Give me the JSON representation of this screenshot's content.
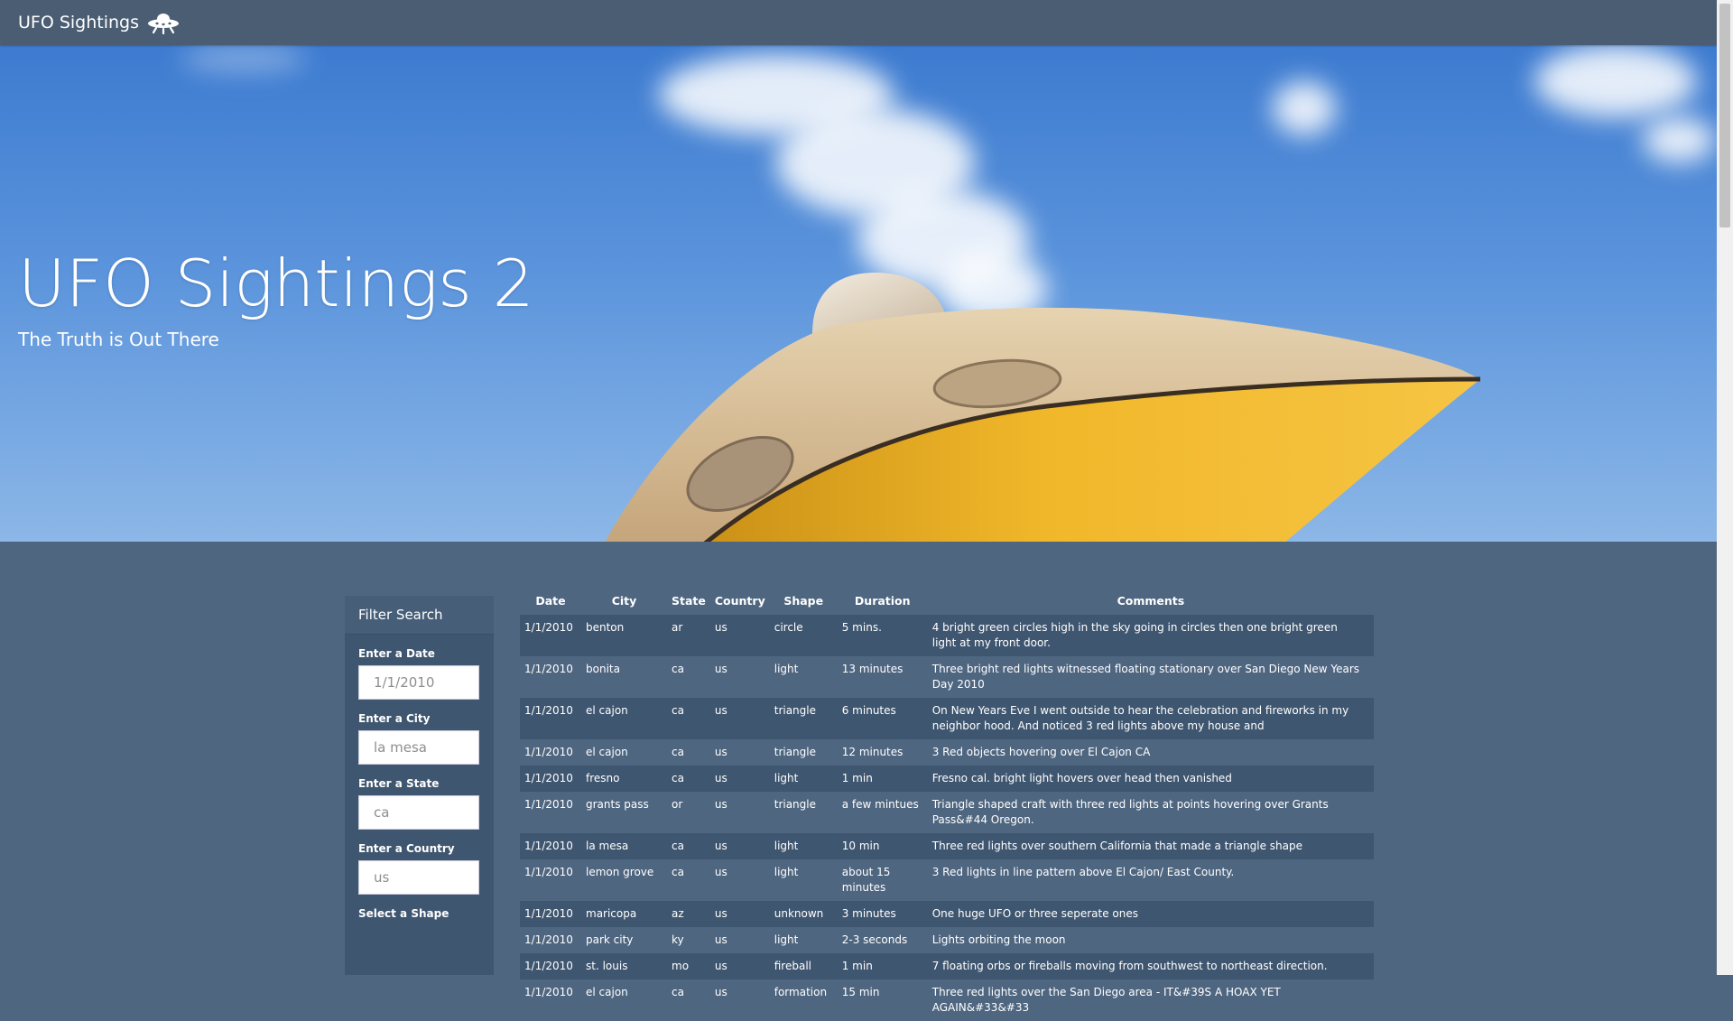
{
  "nav": {
    "brand": "UFO Sightings"
  },
  "hero": {
    "title": "UFO Sightings 2",
    "subtitle": "The Truth is Out There"
  },
  "filter": {
    "heading": "Filter Search",
    "date_label": "Enter a Date",
    "date_placeholder": "1/1/2010",
    "city_label": "Enter a City",
    "city_placeholder": "la mesa",
    "state_label": "Enter a State",
    "state_placeholder": "ca",
    "country_label": "Enter a Country",
    "country_placeholder": "us",
    "shape_label": "Select a Shape"
  },
  "table": {
    "headers": [
      "Date",
      "City",
      "State",
      "Country",
      "Shape",
      "Duration",
      "Comments"
    ],
    "rows": [
      [
        "1/1/2010",
        "benton",
        "ar",
        "us",
        "circle",
        "5 mins.",
        "4 bright green circles high in the sky going in circles then one bright green light at my front door."
      ],
      [
        "1/1/2010",
        "bonita",
        "ca",
        "us",
        "light",
        "13 minutes",
        "Three bright red lights witnessed floating stationary over San Diego New Years Day 2010"
      ],
      [
        "1/1/2010",
        "el cajon",
        "ca",
        "us",
        "triangle",
        "6 minutes",
        "On New Years Eve I went outside to hear the celebration and fireworks in my neighbor hood. And noticed 3 red lights above my house and"
      ],
      [
        "1/1/2010",
        "el cajon",
        "ca",
        "us",
        "triangle",
        "12 minutes",
        "3 Red objects hovering over El Cajon CA"
      ],
      [
        "1/1/2010",
        "fresno",
        "ca",
        "us",
        "light",
        "1 min",
        "Fresno cal. bright light hovers over head then vanished"
      ],
      [
        "1/1/2010",
        "grants pass",
        "or",
        "us",
        "triangle",
        "a few mintues",
        "Triangle shaped craft with three red lights at points hovering over Grants Pass&#44 Oregon."
      ],
      [
        "1/1/2010",
        "la mesa",
        "ca",
        "us",
        "light",
        "10 min",
        "Three red lights over southern California that made a triangle shape"
      ],
      [
        "1/1/2010",
        "lemon grove",
        "ca",
        "us",
        "light",
        "about 15 minutes",
        "3 Red lights in line pattern above El Cajon/ East County."
      ],
      [
        "1/1/2010",
        "maricopa",
        "az",
        "us",
        "unknown",
        "3 minutes",
        "One huge UFO or three seperate ones"
      ],
      [
        "1/1/2010",
        "park city",
        "ky",
        "us",
        "light",
        "2-3 seconds",
        "Lights orbiting the moon"
      ],
      [
        "1/1/2010",
        "st. louis",
        "mo",
        "us",
        "fireball",
        "1 min",
        "7 floating orbs or fireballs moving from southwest to northeast direction."
      ],
      [
        "1/1/2010",
        "el cajon",
        "ca",
        "us",
        "formation",
        "15 min",
        "Three red lights over the San Diego area - IT&#39S A HOAX YET AGAIN&#33&#33"
      ]
    ]
  }
}
